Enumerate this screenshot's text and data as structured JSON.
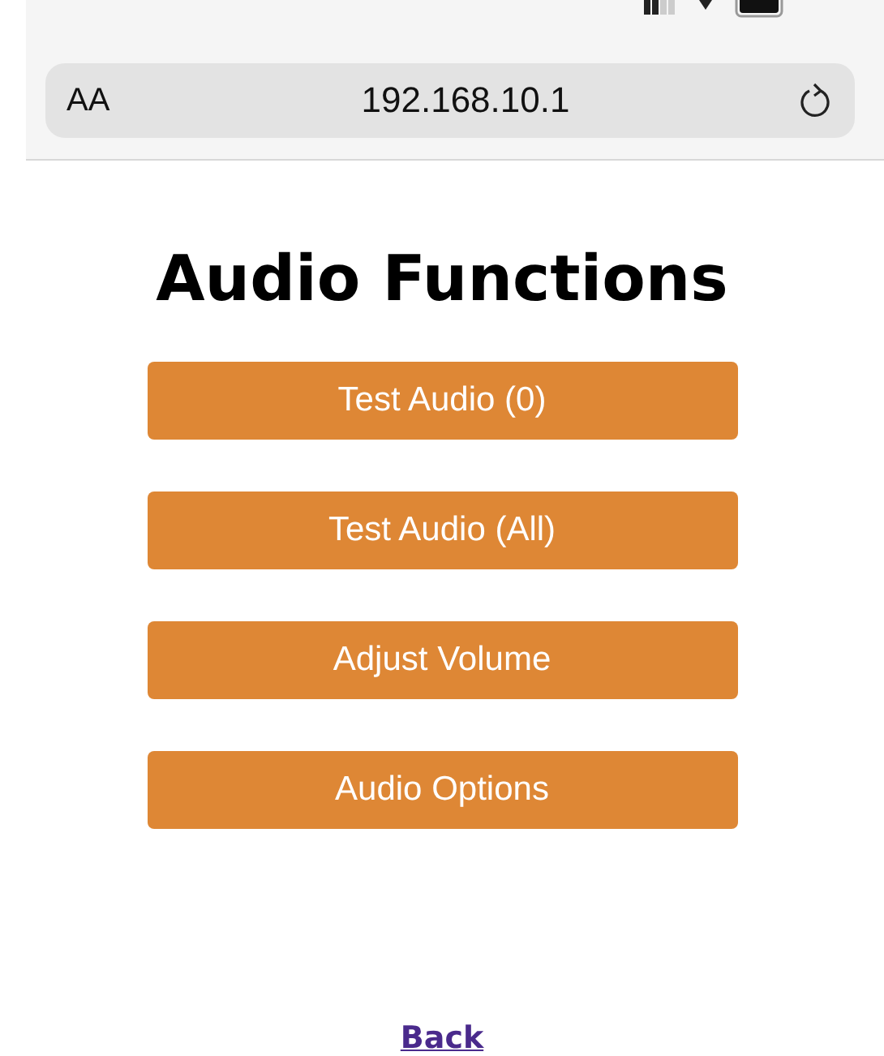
{
  "browser_bar": {
    "text_size_control": "AA",
    "address": "192.168.10.1"
  },
  "page": {
    "title": "Audio Functions",
    "buttons": [
      {
        "label": "Test Audio (0)"
      },
      {
        "label": "Test Audio (All)"
      },
      {
        "label": "Adjust Volume"
      },
      {
        "label": "Audio Options"
      }
    ],
    "back_link": "Back"
  }
}
